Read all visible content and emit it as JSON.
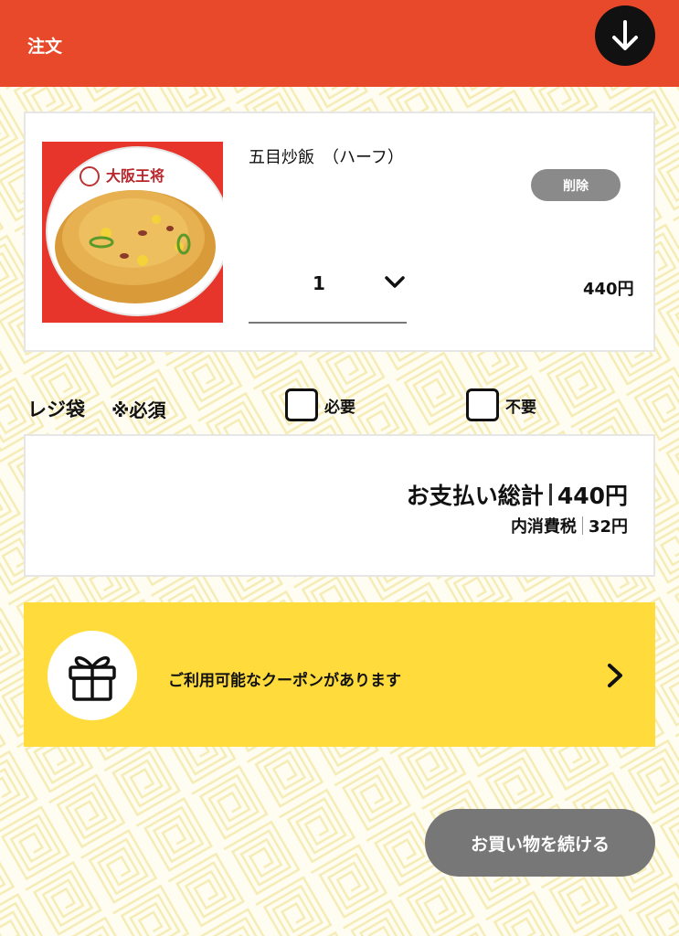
{
  "header": {
    "title": "注文"
  },
  "cart": {
    "items": [
      {
        "name": "五目炒飯　（ハーフ）",
        "delete_label": "削除",
        "quantity": "1",
        "price": "440円",
        "image_logo_text": "大阪王将"
      }
    ]
  },
  "bag": {
    "title": "レジ袋",
    "required_label": "※必須",
    "options": [
      "必要",
      "不要"
    ]
  },
  "totals": {
    "total_label": "お支払い総計",
    "total_value": "440円",
    "tax_label": "内消費税",
    "tax_value": "32円"
  },
  "coupon": {
    "text": "ご利用可能なクーポンがあります"
  },
  "actions": {
    "continue_label": "お買い物を続ける"
  },
  "colors": {
    "header": "#e8492b",
    "coupon": "#ffdc3b",
    "button_gray": "#777777"
  }
}
